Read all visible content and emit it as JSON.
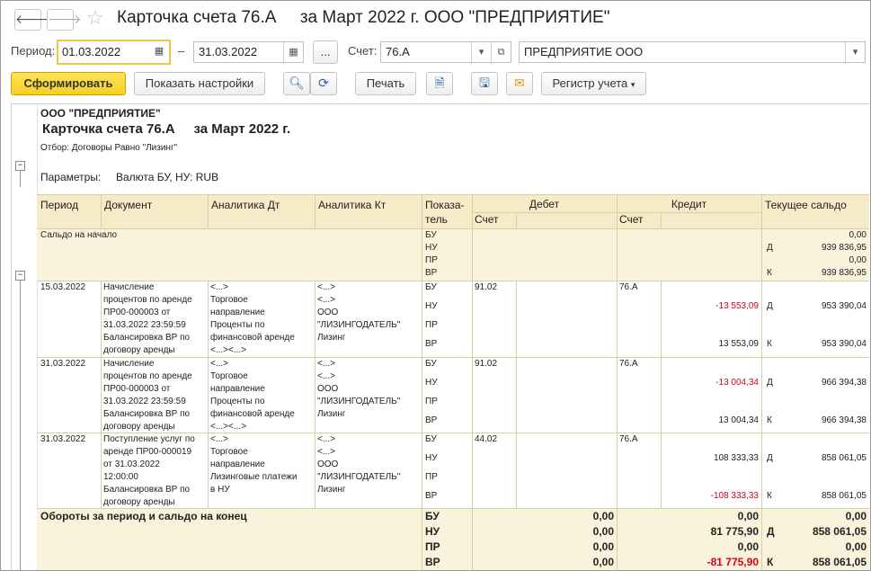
{
  "window": {
    "back_icon": "arrow-left-icon",
    "forward_icon": "arrow-right-icon",
    "favorite_icon": "star-icon",
    "title": "Карточка счета 76.А     за Март 2022 г. ООО \"ПРЕДПРИЯТИЕ\""
  },
  "filters": {
    "period_label": "Период:",
    "date_from": "01.03.2022",
    "dash": "–",
    "date_to": "31.03.2022",
    "ellipsis": "...",
    "account_label": "Счет:",
    "account": "76.А",
    "organization": "ПРЕДПРИЯТИЕ ООО"
  },
  "toolbar": {
    "generate": "Сформировать",
    "show_settings": "Показать настройки",
    "print": "Печать",
    "accounting_register": "Регистр учета"
  },
  "report": {
    "org": "ООО \"ПРЕДПРИЯТИЕ\"",
    "title": "Карточка счета 76.А     за Март 2022 г.",
    "filter": "Отбор: Договоры Равно \"Лизинг\"",
    "params": "Параметры:     Валюта БУ, НУ: RUB",
    "columns": {
      "period": "Период",
      "document": "Документ",
      "analytics_dt": "Аналитика Дт",
      "analytics_kt": "Аналитика Кт",
      "indicator": "Показа-\nтель",
      "debit": "Дебет",
      "credit": "Кредит",
      "balance": "Текущее сальдо",
      "account": "Счет",
      "account2": "Счет"
    },
    "opening": {
      "label": "Сальдо на начало",
      "indicators": [
        "БУ",
        "НУ",
        "ПР",
        "ВР"
      ],
      "dk": [
        "",
        "Д",
        "",
        "К"
      ],
      "balance": [
        "0,00",
        "939 836,95",
        "0,00",
        "939 836,95"
      ]
    },
    "rows": [
      {
        "period": "15.03.2022",
        "document": "Начисление\nпроцентов по аренде\nПР00-000003 от\n31.03.2022 23:59:59\nБалансировка ВР по\nдоговору аренды",
        "analytics_dt": "<...>\nТорговое\nнаправление\nПроценты по\nфинансовой аренде\n<...><...>",
        "analytics_kt": "<...>\n<...>\nООО\n\"ЛИЗИНГОДАТЕЛЬ\"\nЛизинг",
        "debit_account": "91.02",
        "credit_account": "76.А",
        "indicators": [
          "БУ",
          "НУ",
          "ПР",
          "ВР"
        ],
        "credit": [
          "",
          "-13 553,09",
          "",
          "13 553,09"
        ],
        "dk": [
          "",
          "Д",
          "",
          "К"
        ],
        "balance": [
          "",
          "953 390,04",
          "",
          "953 390,04"
        ]
      },
      {
        "period": "31.03.2022",
        "document": "Начисление\nпроцентов по аренде\nПР00-000003 от\n31.03.2022 23:59:59\nБалансировка ВР по\nдоговору аренды",
        "analytics_dt": "<...>\nТорговое\nнаправление\nПроценты по\nфинансовой аренде\n<...><...>",
        "analytics_kt": "<...>\n<...>\nООО\n\"ЛИЗИНГОДАТЕЛЬ\"\nЛизинг",
        "debit_account": "91.02",
        "credit_account": "76.А",
        "indicators": [
          "БУ",
          "НУ",
          "ПР",
          "ВР"
        ],
        "credit": [
          "",
          "-13 004,34",
          "",
          "13 004,34"
        ],
        "dk": [
          "",
          "Д",
          "",
          "К"
        ],
        "balance": [
          "",
          "966 394,38",
          "",
          "966 394,38"
        ]
      },
      {
        "period": "31.03.2022",
        "document": "Поступление услуг по\nаренде ПР00-000019\nот 31.03.2022\n12:00:00\nБалансировка ВР по\nдоговору аренды",
        "analytics_dt": "<...>\nТорговое\nнаправление\nЛизинговые платежи\nв НУ",
        "analytics_kt": "<...>\n<...>\nООО\n\"ЛИЗИНГОДАТЕЛЬ\"\nЛизинг",
        "debit_account": "44.02",
        "credit_account": "76.А",
        "indicators": [
          "БУ",
          "НУ",
          "ПР",
          "ВР"
        ],
        "credit": [
          "",
          "108 333,33",
          "",
          "-108 333,33"
        ],
        "dk": [
          "",
          "Д",
          "",
          "К"
        ],
        "balance": [
          "",
          "858 061,05",
          "",
          "858 061,05"
        ]
      }
    ],
    "totals": {
      "label": "Обороты за период и сальдо на конец",
      "indicators": [
        "БУ",
        "НУ",
        "ПР",
        "ВР"
      ],
      "debit": [
        "0,00",
        "0,00",
        "0,00",
        "0,00"
      ],
      "credit": [
        "0,00",
        "81 775,90",
        "0,00",
        "-81 775,90"
      ],
      "dk": [
        "",
        "Д",
        "",
        "К"
      ],
      "balance": [
        "0,00",
        "858 061,05",
        "0,00",
        "858 061,05"
      ]
    }
  },
  "colors": {
    "primary_button": "#f6cf1d",
    "header_bg": "#f5ebc7",
    "row_bg": "#faf3dc",
    "negative": "#d0021b"
  }
}
